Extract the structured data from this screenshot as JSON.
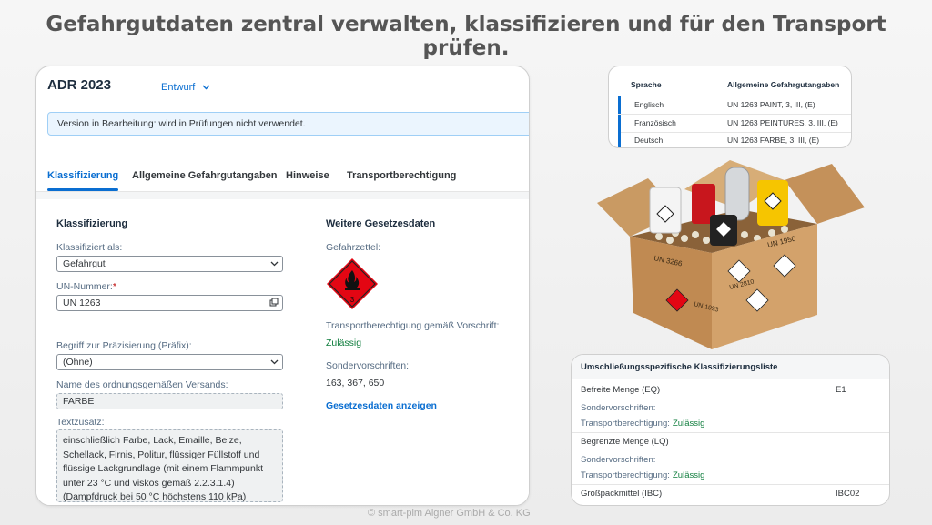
{
  "headline": "Gefahrgutdaten zentral verwalten, klassifizieren und für den Transport prüfen.",
  "footer": "© smart-plm Aigner GmbH & Co. KG",
  "object": {
    "title": "ADR 2023",
    "version_status": "Entwurf",
    "message": "Version in Bearbeitung: wird in Prüfungen nicht verwendet."
  },
  "tabs": [
    {
      "label": "Klassifizierung",
      "active": true
    },
    {
      "label": "Allgemeine Gefahrgutangaben",
      "active": false
    },
    {
      "label": "Hinweise",
      "active": false
    },
    {
      "label": "Transportberechtigung",
      "active": false
    }
  ],
  "classification": {
    "section_title": "Klassifizierung",
    "classified_as_label": "Klassifiziert als:",
    "classified_as_value": "Gefahrgut",
    "un_number_label": "UN-Nummer:",
    "un_number_required": "*",
    "un_number_value": "UN 1263",
    "prefix_label": "Begriff zur Präzisierung (Präfix):",
    "prefix_value": "(Ohne)",
    "shipping_name_label": "Name des ordnungsgemäßen Versands:",
    "shipping_name_value": "FARBE",
    "text_supplement_label": "Textzusatz:",
    "text_supplement_lines": [
      "einschließlich Farbe, Lack, Emaille, Beize,",
      "Schellack, Firnis, Politur, flüssiger Füllstoff und",
      "flüssige Lackgrundlage (mit einem Flammpunkt",
      "unter 23 °C und viskos gemäß 2.2.3.1.4)",
      "(Dampfdruck bei 50 °C höchstens 110 kPa)"
    ]
  },
  "further_data": {
    "section_title": "Weitere Gesetzesdaten",
    "hazard_label_label": "Gefahrzettel:",
    "hazard_label_number": "3",
    "transport_permission_label": "Transportberechtigung gemäß Vorschrift:",
    "transport_permission_value": "Zulässig",
    "special_provisions_label": "Sondervorschriften:",
    "special_provisions_value": "163, 367, 650",
    "show_link": "Gesetzesdaten anzeigen"
  },
  "languages": {
    "col_language": "Sprache",
    "col_general": "Allgemeine Gefahrgutangaben",
    "rows": [
      {
        "language": "Englisch",
        "text": "UN 1263 PAINT, 3, III, (E)"
      },
      {
        "language": "Französisch",
        "text": "UN 1263 PEINTURES, 3, III, (E)"
      },
      {
        "language": "Deutsch",
        "text": "UN 1263 FARBE, 3, III, (E)"
      }
    ]
  },
  "box_labels": {
    "un_3266": "UN 3266",
    "un_1950": "UN 1950",
    "un_1993": "UN 1993",
    "un_2810": "UN 2810"
  },
  "mode_list": {
    "title": "Umschließungsspezifische Klassifizierungsliste",
    "eq_label": "Befreite Menge (EQ)",
    "eq_value": "E1",
    "special_label": "Sondervorschriften:",
    "permission_label": "Transportberechtigung:",
    "permission_value": "Zulässig",
    "lq_label": "Begrenzte Menge (LQ)",
    "ibc_label": "Großpackmittel (IBC)",
    "ibc_value": "IBC02"
  },
  "colors": {
    "accent": "#0a6ed1",
    "success": "#107e3e",
    "hazard_red": "#e30613"
  }
}
